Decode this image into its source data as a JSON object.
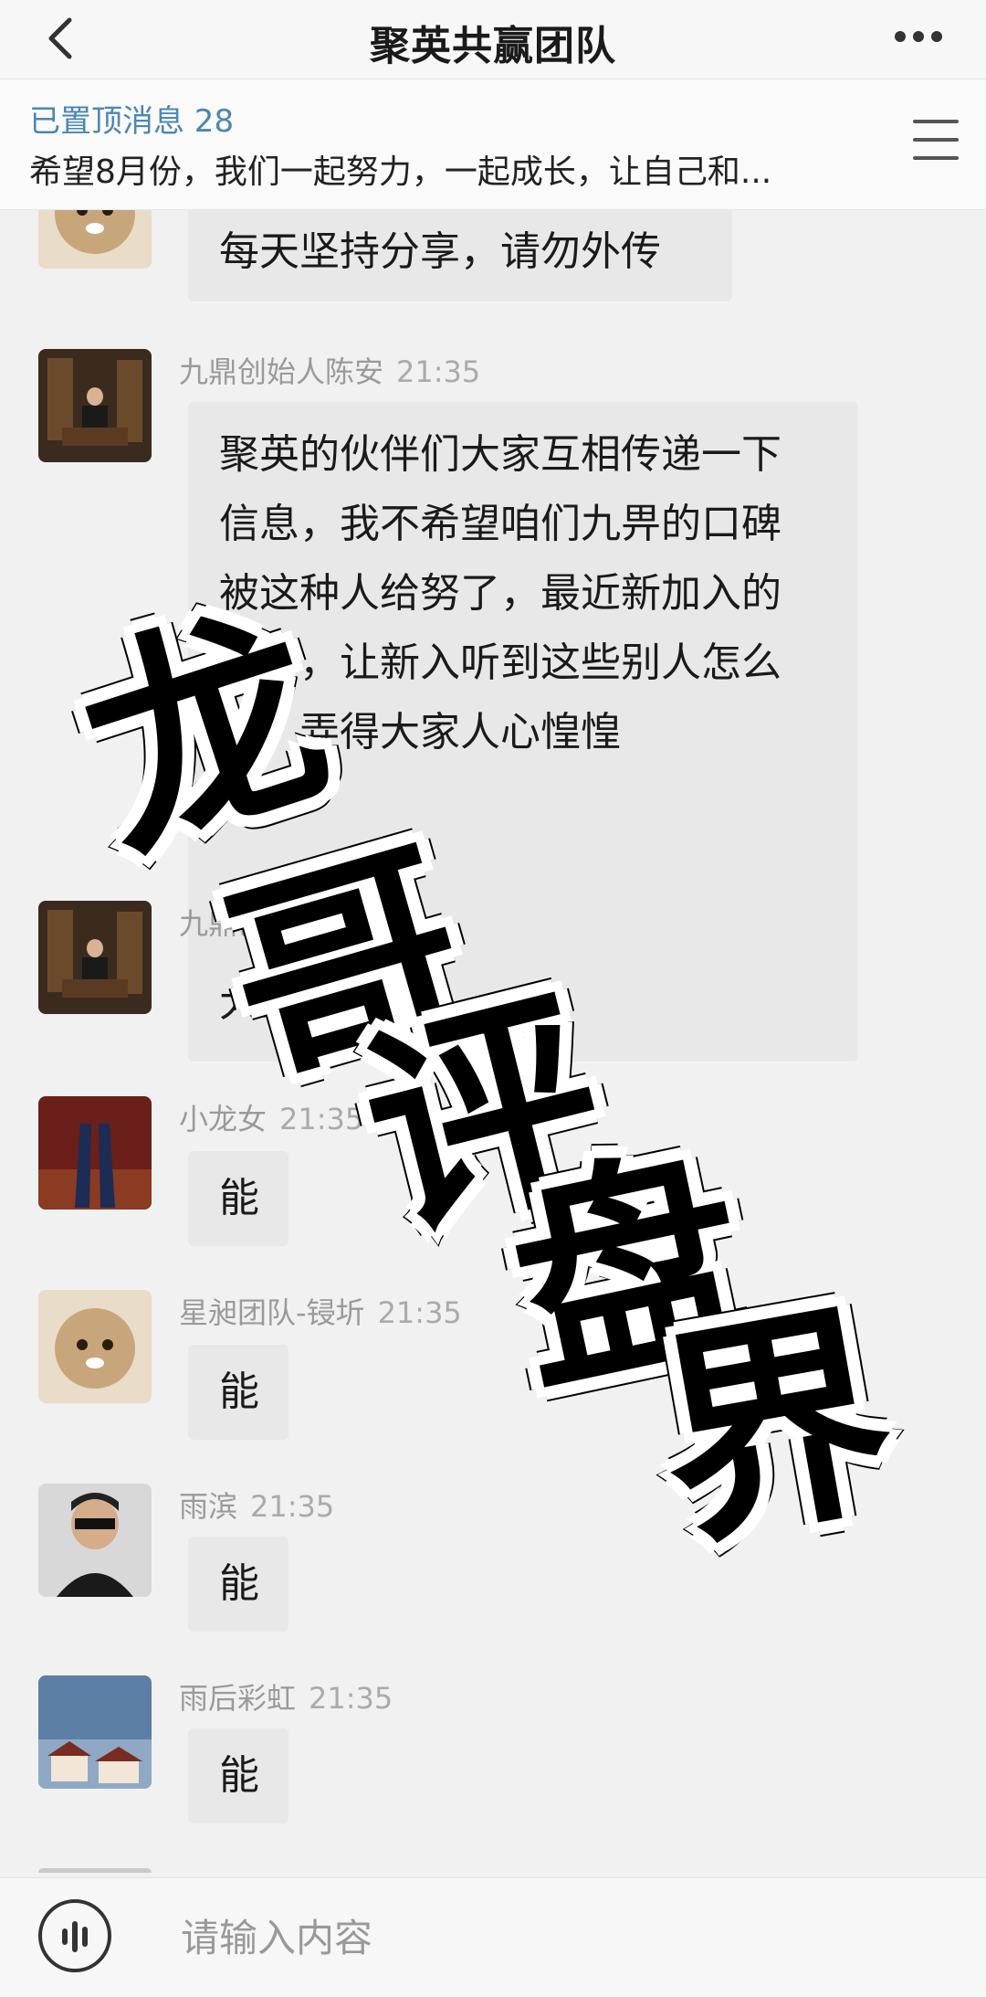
{
  "header": {
    "title": "聚英共赢团队",
    "back_icon": "chevron-left-icon",
    "more_icon": "more-dots-icon"
  },
  "pinned": {
    "count_label": "已置顶消息 28",
    "text": "希望8月份，我们一起努力，一起成长，让自己和...",
    "menu_icon": "list-menu-icon"
  },
  "messages": [
    {
      "sender": "",
      "time": "",
      "text": "每天坚持分享，请勿外传"
    },
    {
      "sender": "九鼎创始人陈安",
      "time": "21:35",
      "text": "聚英的伙伴们大家互相传递一下信息，我不希望咱们九畀的口碑被这种人给努了，最近新加入的也多，让新入听到这些别人怎么想，弄得大家人心惶惶"
    },
    {
      "sender": "九鼎创",
      "time": "",
      "text": "大家能"
    },
    {
      "sender": "小龙女",
      "time": "21:35",
      "text": "能"
    },
    {
      "sender": "星昶团队-锓圻",
      "time": "21:35",
      "text": "能"
    },
    {
      "sender": "雨滨",
      "time": "21:35",
      "text": "能"
    },
    {
      "sender": "雨后彩虹",
      "time": "21:35",
      "text": "能"
    }
  ],
  "input": {
    "placeholder": "请输入内容",
    "voice_icon": "voice-wave-icon"
  },
  "watermark": {
    "text": "龙哥评盘界"
  },
  "colors": {
    "pinned_count": "#4b86b4",
    "bubble_bg": "#e8e8e8",
    "page_bg": "#f1f1f1"
  }
}
